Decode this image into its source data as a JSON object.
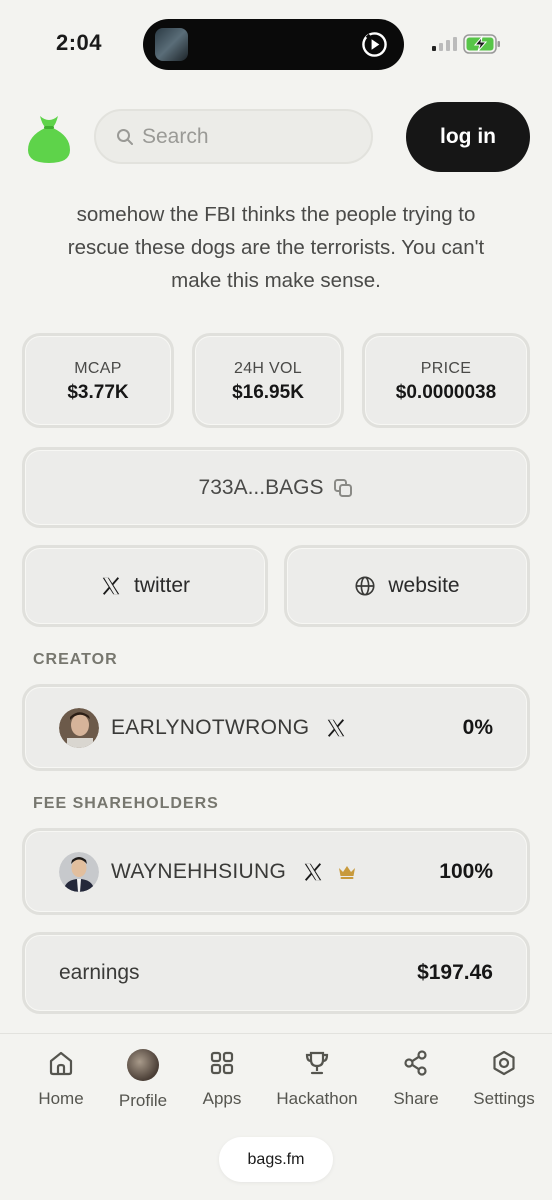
{
  "status_bar": {
    "time": "2:04"
  },
  "header": {
    "search_placeholder": "Search",
    "login_label": "log in"
  },
  "description": {
    "lines": [
      "somehow the FBI thinks the people trying to",
      "rescue these dogs are the terrorists. You can't",
      "make this make sense."
    ]
  },
  "stats": [
    {
      "label": "MCAP",
      "value": "$3.77K"
    },
    {
      "label": "24H VOL",
      "value": "$16.95K"
    },
    {
      "label": "PRICE",
      "value": "$0.0000038"
    }
  ],
  "token_address": "733A...BAGS",
  "links": {
    "twitter_label": "twitter",
    "website_label": "website"
  },
  "creator": {
    "section_label": "CREATOR",
    "name": "EARLYNOTWRONG",
    "percent": "0%"
  },
  "fee_shareholders": {
    "section_label": "FEE SHAREHOLDERS",
    "name": "WAYNEHHSIUNG",
    "percent": "100%"
  },
  "earnings": {
    "label": "earnings",
    "value": "$197.46"
  },
  "nav": [
    {
      "label": "Home",
      "icon": "home-icon"
    },
    {
      "label": "Profile",
      "icon": "avatar"
    },
    {
      "label": "Apps",
      "icon": "grid-icon"
    },
    {
      "label": "Hackathon",
      "icon": "trophy-icon"
    },
    {
      "label": "Share",
      "icon": "share-icon"
    },
    {
      "label": "Settings",
      "icon": "settings-icon"
    }
  ],
  "browser": {
    "url": "bags.fm"
  },
  "colors": {
    "brand_green": "#5ed34a",
    "dark_button": "#161616",
    "crown_gold": "#c89a3c"
  }
}
